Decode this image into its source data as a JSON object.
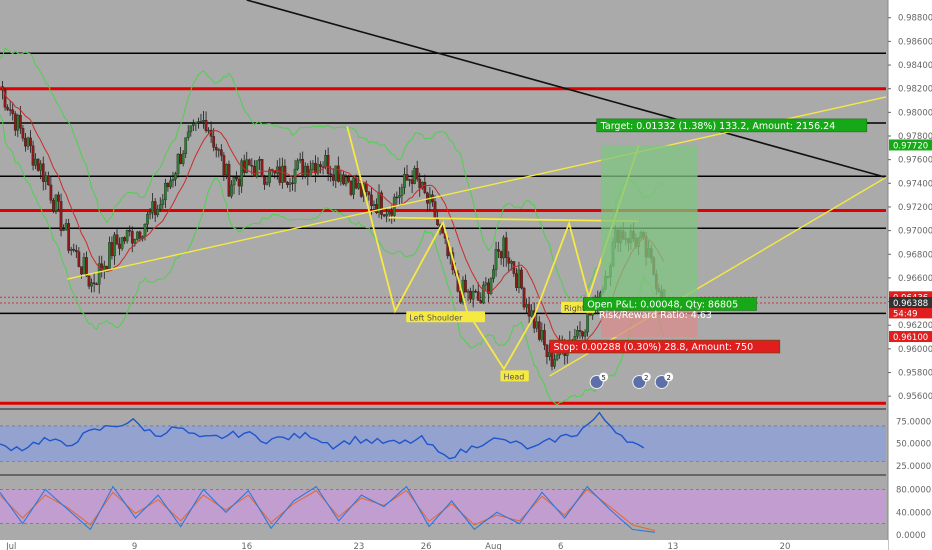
{
  "colors": {
    "background": "#aaaaaa",
    "price_up": "#2e7d32",
    "price_down": "#8b1a1a",
    "sma": "#cc2a2a",
    "bollinger": "#4fd04f",
    "pattern": "#f5e942",
    "rsi": "#1f55cc",
    "rsi_band": "#8fa0d8",
    "stoch_band": "#c89ad8",
    "stoch_k": "#2a7ad8",
    "stoch_d": "#e36b3a",
    "target_zone": "#7fc47f",
    "stop_zone": "#d98b8b",
    "badge_green": "#17a817",
    "badge_red": "#e01e1e",
    "badge_dark": "#333333"
  },
  "chart_data": [
    {
      "type": "candlestick",
      "panel": "price",
      "ylim": [
        0.955,
        0.9895
      ],
      "y_ticks": [
        "0.98800",
        "0.98600",
        "0.98400",
        "0.98200",
        "0.98000",
        "0.97800",
        "0.97600",
        "0.97400",
        "0.97200",
        "0.97000",
        "0.96800",
        "0.96600",
        "0.96400",
        "0.96200",
        "0.96000",
        "0.95800",
        "0.95600"
      ],
      "x_ticks": [
        {
          "label": "Jul",
          "x": 0.5
        },
        {
          "label": "9",
          "x": 6
        },
        {
          "label": "16",
          "x": 11
        },
        {
          "label": "23",
          "x": 16
        },
        {
          "label": "26",
          "x": 19
        },
        {
          "label": "Aug",
          "x": 22
        },
        {
          "label": "6",
          "x": 25
        },
        {
          "label": "13",
          "x": 30
        },
        {
          "label": "20",
          "x": 35
        }
      ],
      "xlim": [
        0,
        39.5
      ],
      "close": [
        0.9822,
        0.978,
        0.9745,
        0.969,
        0.9655,
        0.9688,
        0.97,
        0.9722,
        0.977,
        0.9795,
        0.974,
        0.9755,
        0.9745,
        0.9752,
        0.976,
        0.9748,
        0.9728,
        0.972,
        0.9748,
        0.9712,
        0.965,
        0.964,
        0.969,
        0.964,
        0.959,
        0.961,
        0.9635,
        0.97,
        0.969,
        0.9645
      ],
      "horizontal_lines": [
        {
          "value": 0.985,
          "color": "#000000"
        },
        {
          "value": 0.982,
          "color": "#e00000"
        },
        {
          "value": 0.9791,
          "color": "#000000"
        },
        {
          "value": 0.9746,
          "color": "#000000"
        },
        {
          "value": 0.9717,
          "color": "#e00000"
        },
        {
          "value": 0.9702,
          "color": "#000000"
        },
        {
          "value": 0.963,
          "color": "#000000"
        },
        {
          "value": 0.9554,
          "color": "#e00000"
        }
      ],
      "price_labels": [
        {
          "text": "0.97720",
          "value": 0.9772,
          "bg": "#17a817"
        },
        {
          "text": "0.96436",
          "value": 0.96436,
          "bg": "#e01e1e"
        },
        {
          "text": "54:49",
          "value": 0.963,
          "bg": "#e01e1e"
        },
        {
          "text": "0.96388",
          "value": 0.96388,
          "bg": "#333333"
        },
        {
          "text": "0.96100",
          "value": 0.961,
          "bg": "#e01e1e"
        }
      ],
      "pattern_labels": [
        "Left Shoulder",
        "Head",
        "Right"
      ],
      "event_badges": [
        "5",
        "2",
        "2"
      ],
      "annotations": {
        "target": "Target: 0.01332 (1.38%) 133.2, Amount: 2156.24",
        "open_pl": "Open P&L: 0.00048, Qty: 86805",
        "risk_reward": "Risk/Reward Ratio: 4.63",
        "stop": "Stop: 0.00288 (0.30%) 28.8, Amount: 750"
      }
    },
    {
      "type": "line",
      "panel": "rsi",
      "ylim": [
        18,
        88
      ],
      "y_ticks": [
        "75.0000",
        "50.0000",
        "25.0000"
      ],
      "band": [
        30,
        70
      ],
      "values": [
        47,
        45,
        55,
        48,
        62,
        70,
        75,
        60,
        68,
        55,
        58,
        62,
        54,
        57,
        60,
        48,
        55,
        52,
        50,
        55,
        35,
        42,
        55,
        52,
        44,
        55,
        62,
        82,
        60,
        42
      ]
    },
    {
      "type": "line",
      "panel": "stochastic",
      "ylim": [
        -5,
        100
      ],
      "y_ticks": [
        "80.0000",
        "40.0000",
        "0.0000"
      ],
      "band": [
        20,
        80
      ],
      "k": [
        75,
        20,
        80,
        45,
        10,
        85,
        30,
        70,
        15,
        80,
        40,
        78,
        12,
        60,
        85,
        25,
        70,
        50,
        85,
        15,
        60,
        10,
        40,
        20,
        75,
        30,
        85,
        45,
        10,
        5
      ],
      "d": [
        70,
        30,
        70,
        48,
        18,
        75,
        38,
        62,
        25,
        70,
        44,
        70,
        22,
        55,
        78,
        32,
        65,
        52,
        78,
        24,
        55,
        18,
        35,
        25,
        68,
        35,
        80,
        50,
        18,
        8
      ]
    }
  ]
}
